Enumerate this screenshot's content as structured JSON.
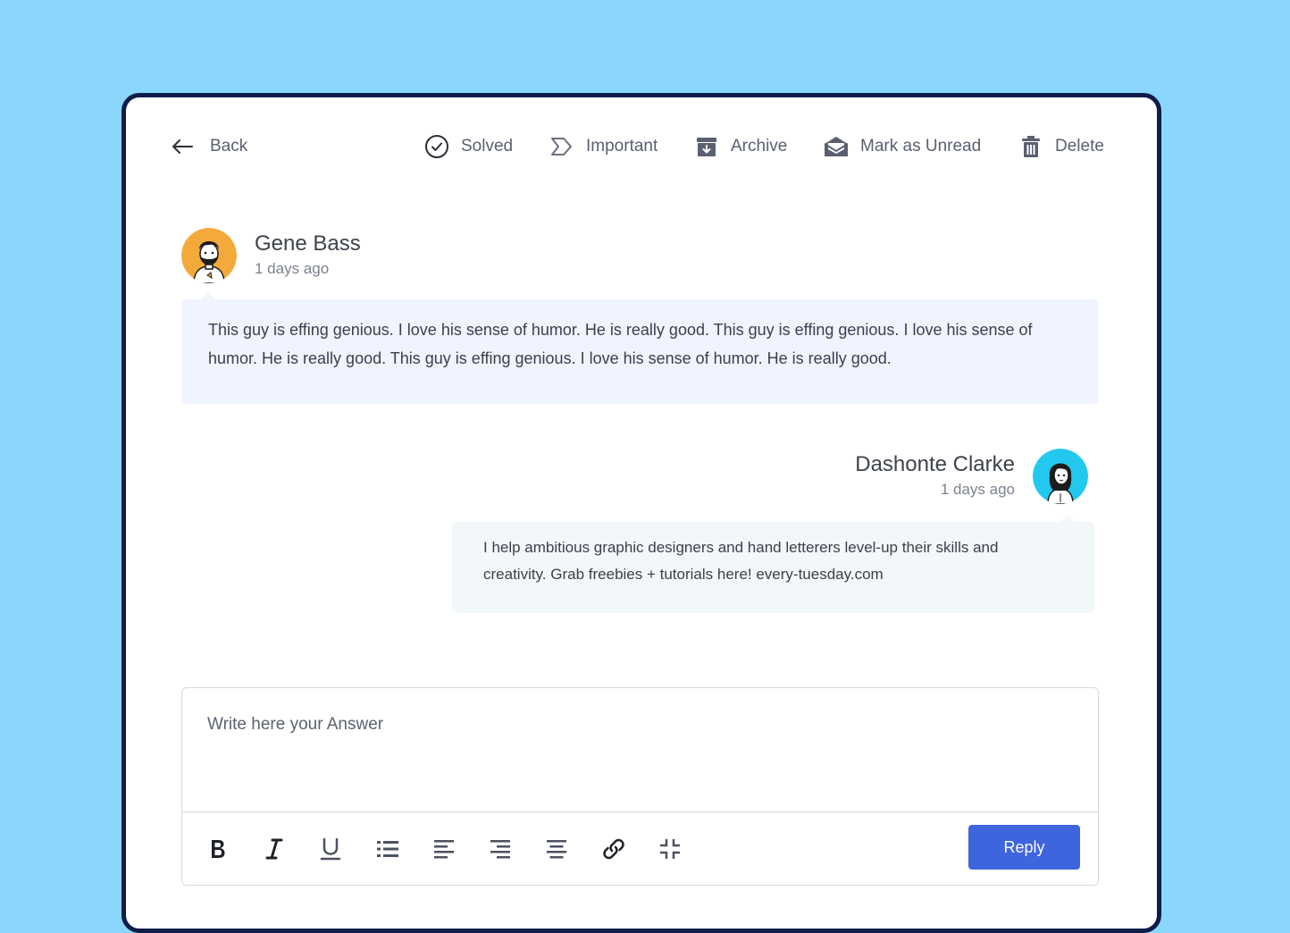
{
  "toolbar": {
    "back_label": "Back",
    "solved_label": "Solved",
    "important_label": "Important",
    "archive_label": "Archive",
    "mark_unread_label": "Mark as Unread",
    "delete_label": "Delete"
  },
  "messages": [
    {
      "author": "Gene Bass",
      "time": "1 days ago",
      "avatar_color": "#F4A93B",
      "body": "This guy is effing genious. I love his sense of humor. He is really good. This guy is effing genious. I love his sense of humor. He is really good. This guy is effing genious. I love his sense of humor. He is really good."
    },
    {
      "author": "Dashonte Clarke",
      "time": "1 days ago",
      "avatar_color": "#22C8EE",
      "body": "I help ambitious graphic designers and hand letterers level-up their skills and creativity. Grab freebies + tutorials here! every-tuesday.com"
    }
  ],
  "editor": {
    "placeholder": "Write here your Answer",
    "value": "",
    "reply_label": "Reply",
    "reply_color": "#3E64DE"
  },
  "colors": {
    "background": "#8AD7FB",
    "card_border": "#0F1D4A",
    "bubble_incoming": "#EFF4FE",
    "bubble_outgoing": "#F2F7FA"
  }
}
